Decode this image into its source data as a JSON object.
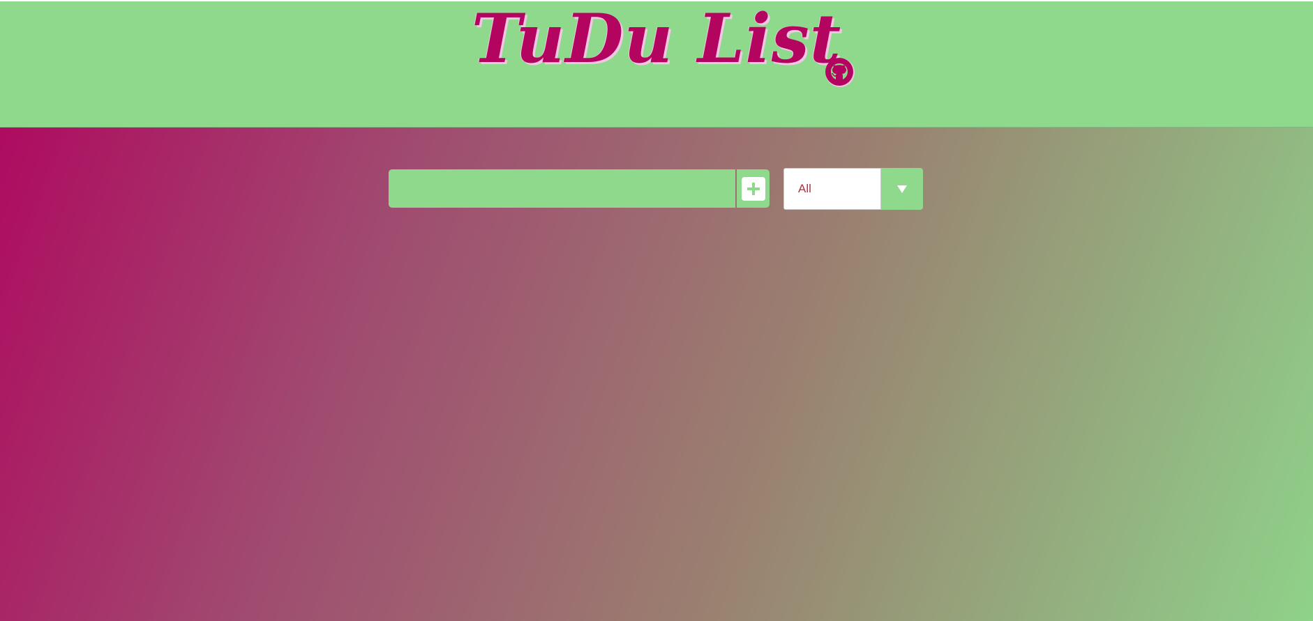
{
  "header": {
    "title": "TuDu List",
    "github_icon": "github-icon"
  },
  "form": {
    "input_value": "",
    "input_placeholder": "",
    "add_icon": "plus-icon"
  },
  "filter": {
    "selected": "All",
    "arrow_icon": "caret-down-icon"
  },
  "todos": [],
  "colors": {
    "accent": "#b3045f",
    "header_bg": "#8fd98c",
    "title_shadow": "#f3c6e4",
    "select_text": "#b03040"
  }
}
